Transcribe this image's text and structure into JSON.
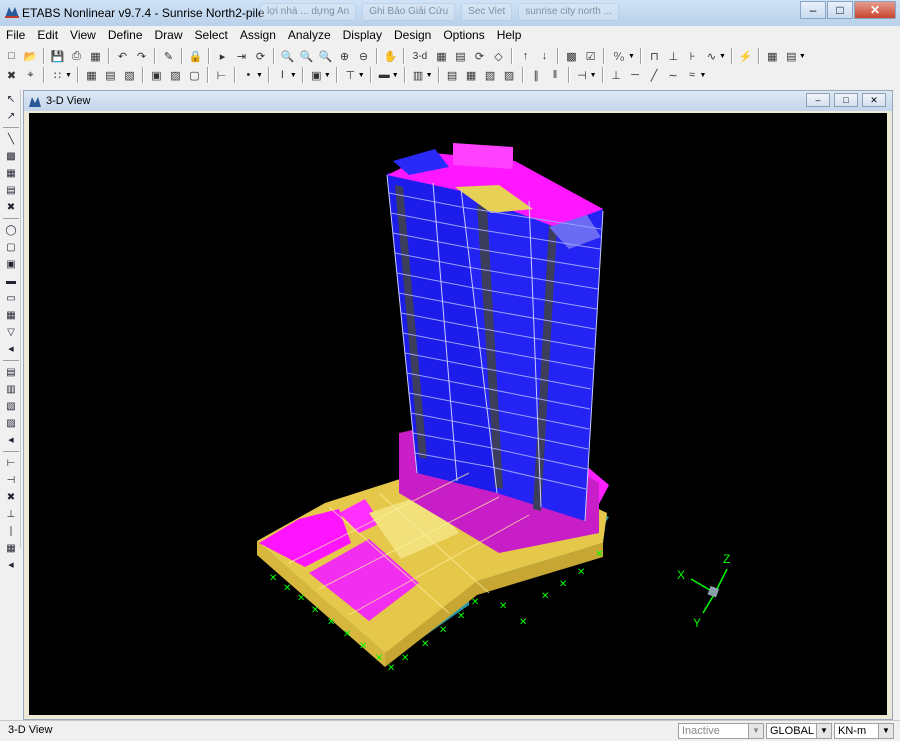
{
  "window": {
    "title": "ETABS Nonlinear v9.7.4 - Sunrise North2-pile",
    "background_tabs": [
      "lợi nhà ... dựng An",
      "Ghi Bảo Giải Cứu",
      "Sec Viet",
      "sunrise city north ..."
    ]
  },
  "menu": [
    "File",
    "Edit",
    "View",
    "Define",
    "Draw",
    "Select",
    "Assign",
    "Analyze",
    "Display",
    "Design",
    "Options",
    "Help"
  ],
  "toolbar": {
    "view_3d_label": "3-d",
    "units_fraction": "⁰⁄₀"
  },
  "child_window": {
    "title": "3-D View"
  },
  "axes": {
    "x": "X",
    "y": "Y",
    "z": "Z"
  },
  "status": {
    "text": "3-D View",
    "mode": "Inactive",
    "coord_system": "GLOBAL",
    "units": "KN-m"
  },
  "colors": {
    "background": "#000000",
    "shell_blue": "#1e1ef0",
    "slab_magenta": "#ff00ff",
    "slab_yellow": "#e8d050",
    "support_green": "#00ff00"
  }
}
